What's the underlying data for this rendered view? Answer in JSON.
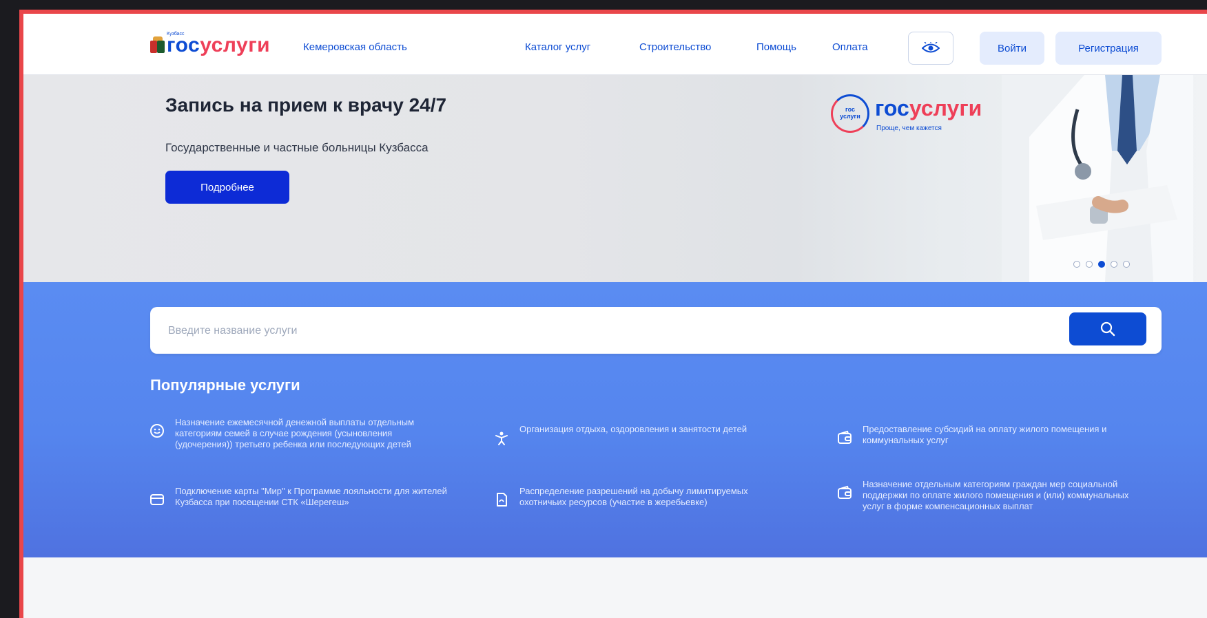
{
  "header": {
    "logo": {
      "gos": "гос",
      "uslugi": "услуги",
      "tag": "Кузбасс"
    },
    "region": "Кемеровская область",
    "nav": [
      "Каталог услуг",
      "Строительство",
      "Помощь",
      "Оплата"
    ],
    "login_label": "Войти",
    "register_label": "Регистрация"
  },
  "hero": {
    "title": "Запись на прием к врачу 24/7",
    "subtitle": "Государственные и частные больницы Кузбасса",
    "button_label": "Подробнее",
    "logo": {
      "badge": "гос\nуслуги",
      "gos": "гос",
      "uslugi": "услуги",
      "slogan": "Проще, чем кажется"
    },
    "slides_total": 5,
    "active_slide": 3
  },
  "search": {
    "placeholder": "Введите название услуги"
  },
  "popular": {
    "title": "Популярные услуги",
    "items": [
      {
        "icon": "smile-icon",
        "label": "Назначение ежемесячной денежной выплаты отдельным категориям семей в случае рождения (усыновления (удочерения)) третьего ребенка или последующих детей"
      },
      {
        "icon": "child-icon",
        "label": "Организация отдыха, оздоровления и занятости детей"
      },
      {
        "icon": "wallet-icon",
        "label": "Предоставление субсидий на оплату жилого помещения и коммунальных услуг"
      },
      {
        "icon": "card-icon",
        "label": "Подключение карты \"Мир\" к Программе лояльности для жителей Кузбасса при посещении СТК «Шерегеш»"
      },
      {
        "icon": "document-icon",
        "label": "Распределение разрешений на добычу лимитируемых охотничьих ресурсов (участие в жеребьевке)"
      },
      {
        "icon": "wallet-icon",
        "label": "Назначение отдельным категориям граждан мер социальной поддержки по оплате жилого помещения и (или) коммунальных услуг в форме компенсационных выплат"
      }
    ]
  },
  "colors": {
    "brand_blue": "#0d4cd3",
    "brand_red": "#ee3f58",
    "section_blue": "#5a8cf2",
    "frame_red": "#e9464a"
  }
}
